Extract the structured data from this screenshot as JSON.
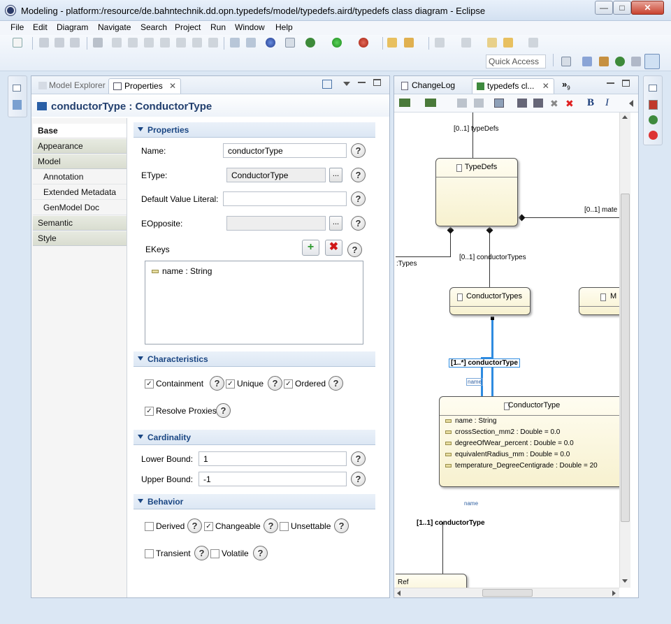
{
  "window": {
    "title": "Modeling - platform:/resource/de.bahntechnik.dd.opn.typedefs/model/typedefs.aird/typedefs class diagram - Eclipse",
    "minimize": "—",
    "maximize": "□",
    "close": "✕"
  },
  "menu": [
    "File",
    "Edit",
    "Diagram",
    "Navigate",
    "Search",
    "Project",
    "Run",
    "Window",
    "Help"
  ],
  "toolbar": {
    "quick_access_placeholder": "Quick Access"
  },
  "properties_view": {
    "tabs": {
      "model_explorer": "Model Explorer",
      "properties": "Properties"
    },
    "header": "conductorType : ConductorType",
    "sidebar": [
      "Base",
      "Appearance",
      "Model",
      "Annotation",
      "Extended Metadata",
      "GenModel Doc",
      "Semantic",
      "Style"
    ],
    "sections": {
      "properties": {
        "title": "Properties",
        "name_label": "Name:",
        "name_value": "conductorType",
        "etype_label": "EType:",
        "etype_value": "ConductorType",
        "default_label": "Default Value Literal:",
        "default_value": "",
        "eopposite_label": "EOpposite:",
        "eopposite_value": "",
        "ekeys_label": "EKeys",
        "ekeys_items": [
          "name : String"
        ],
        "browse": "..."
      },
      "characteristics": {
        "title": "Characteristics",
        "containment": "Containment",
        "containment_checked": true,
        "unique": "Unique",
        "unique_checked": true,
        "ordered": "Ordered",
        "ordered_checked": true,
        "resolve_proxies": "Resolve Proxies",
        "resolve_proxies_checked": true
      },
      "cardinality": {
        "title": "Cardinality",
        "lower_label": "Lower Bound:",
        "lower_value": "1",
        "upper_label": "Upper Bound:",
        "upper_value": "-1"
      },
      "behavior": {
        "title": "Behavior",
        "derived": "Derived",
        "derived_checked": false,
        "changeable": "Changeable",
        "changeable_checked": true,
        "unsettable": "Unsettable",
        "unsettable_checked": false,
        "transient": "Transient",
        "transient_checked": false,
        "volatile": "Volatile",
        "volatile_checked": false
      }
    },
    "help": "?",
    "check_mark": "✓"
  },
  "diagram_view": {
    "tabs": {
      "changelog": "ChangeLog",
      "typedefs": "typedefs cl...",
      "overflow": "»",
      "overflow_count": "9"
    },
    "format": {
      "bold": "B",
      "italic": "I"
    },
    "nodes": {
      "typedefs": "TypeDefs",
      "conductor_types": "ConductorTypes",
      "m_node": "M",
      "conductor_type": "ConductorType",
      "ref": "Ref"
    },
    "attributes": [
      "name : String",
      "crossSection_mm2 : Double = 0.0",
      "degreeOfWear_percent : Double = 0.0",
      "equivalentRadius_mm : Double = 0.0",
      "temperature_DegreeCentigrade : Double = 20"
    ],
    "edge_labels": {
      "typedefs_in": "[0..1] typeDefs",
      "mate": "[0..1] mate",
      "types": ":Types",
      "conductor_types": "[0..1] conductorTypes",
      "conductor_type_selected": "[1..*] conductorType",
      "name_small_1": "name",
      "name_small_2": "name",
      "conductor_type_ref": "[1..1] conductorType"
    }
  }
}
